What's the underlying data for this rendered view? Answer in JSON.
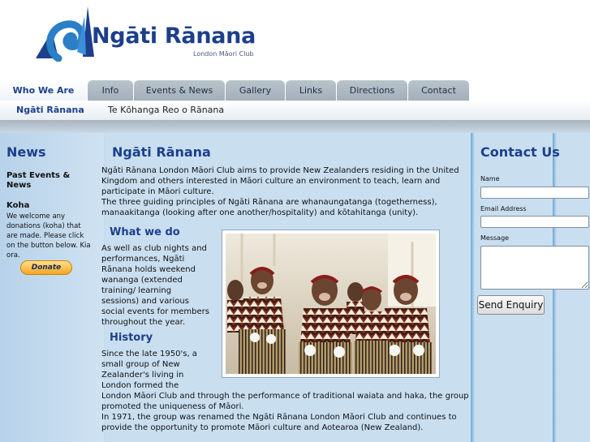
{
  "brand": {
    "name": "Ngāti Rānana",
    "tagline": "London Māori Club",
    "logo_icon": "koru-sail-logo-icon",
    "colors": {
      "primary": "#1d3f8b",
      "accent": "#2a7fc6",
      "content_bg": "#c9dff0"
    }
  },
  "nav": {
    "tabs": [
      {
        "label": "Who We Are",
        "active": true
      },
      {
        "label": "Info"
      },
      {
        "label": "Events & News"
      },
      {
        "label": "Gallery"
      },
      {
        "label": "Links"
      },
      {
        "label": "Directions"
      },
      {
        "label": "Contact"
      }
    ]
  },
  "subnav": {
    "items": [
      {
        "label": "Ngāti Rānana",
        "active": true
      },
      {
        "label": "Te Kōhanga Reo o Rānana"
      }
    ]
  },
  "left": {
    "news_title": "News",
    "past_events": "Past Events & News",
    "koha_title": "Koha",
    "koha_text": "We welcome any donations (koha) that are made.  Please click on the button below.  Kia ora.",
    "donate_label": "Donate"
  },
  "main": {
    "title": "Ngāti Rānana",
    "intro_p1": "Ngāti Rānana London Māori Club aims to provide New Zealanders residing in the United Kingdom and others interested in Māori culture an environment to teach, learn and participate in Māori culture.",
    "intro_p2": "The three guiding principles of Ngāti Rānana are whanaungatanga (togetherness), manaakitanga (looking after one another/hospitality) and kōtahitanga (unity).",
    "what_title": "What we do",
    "what_text": "As well as club nights and performances, Ngāti Rānana holds weekend wananga (extended training/ learning sessions) and various social events for members throughout the year.",
    "history_title": "History",
    "history_a": "Since the late 1950's, a small group of New Zealander's living in London formed the",
    "history_b": "London Māori Club and through the performance of traditional waiata and haka, the group promoted the uniqueness of Māori.",
    "history_c": "In 1971, the group was renamed the Ngāti Rānana London Māori Club and continues to provide the opportunity to promote Māori culture and Aotearoa (New Zealand)."
  },
  "contact": {
    "title": "Contact Us",
    "name_label": "Name",
    "email_label": "Email Address",
    "message_label": "Message",
    "name_value": "",
    "email_value": "",
    "message_value": "",
    "send_label": "Send Enquiry"
  }
}
